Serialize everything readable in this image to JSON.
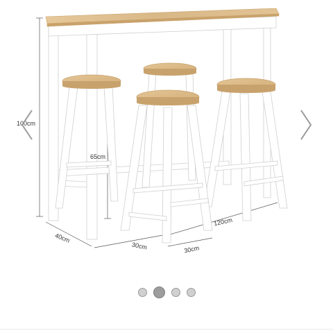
{
  "gallery": {
    "slide_count": 4,
    "active_index": 1,
    "prev_icon": "chevron-left-icon",
    "next_icon": "chevron-right-icon"
  },
  "dimensions": {
    "height": "100cm",
    "stool_height": "65cm",
    "depth": "40cm",
    "length": "120cm",
    "stool_seat_1": "30cm",
    "stool_seat_2": "30cm"
  },
  "colors": {
    "wood": "#dcb98a",
    "frame": "#ffffff",
    "accent_dot": "#9d9d9d"
  }
}
